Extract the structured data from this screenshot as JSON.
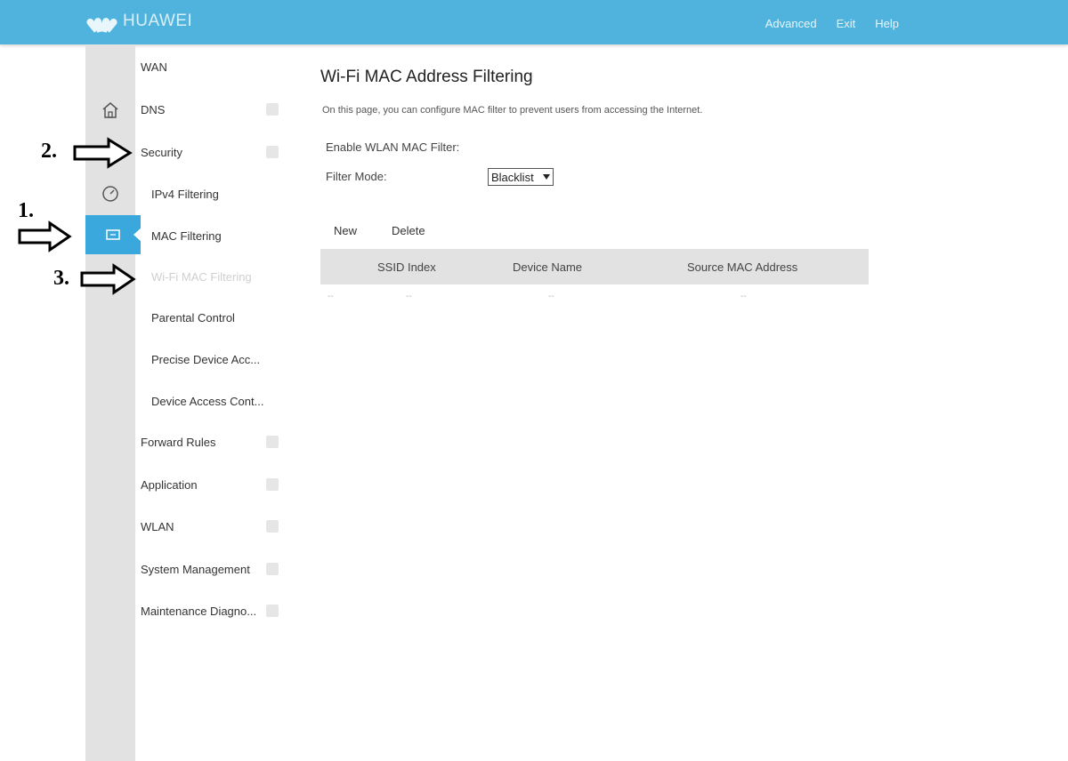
{
  "header": {
    "brand": "HUAWEI",
    "links": [
      "Advanced",
      "Exit",
      "Help"
    ]
  },
  "sidebar": {
    "items": [
      {
        "label": "WAN",
        "type": "header"
      },
      {
        "label": "DNS",
        "type": "header"
      },
      {
        "label": "Security",
        "type": "header"
      },
      {
        "label": "IPv4 Filtering",
        "type": "sub"
      },
      {
        "label": "MAC Filtering",
        "type": "sub"
      },
      {
        "label": "Wi-Fi MAC Filtering",
        "type": "sub"
      },
      {
        "label": "Parental Control",
        "type": "sub"
      },
      {
        "label": "Precise Device Acc...",
        "type": "sub"
      },
      {
        "label": "Device Access Cont...",
        "type": "sub"
      },
      {
        "label": "Forward Rules",
        "type": "header"
      },
      {
        "label": "Application",
        "type": "header"
      },
      {
        "label": "WLAN",
        "type": "header"
      },
      {
        "label": "System Management",
        "type": "header"
      },
      {
        "label": "Maintenance Diagno...",
        "type": "header"
      }
    ]
  },
  "annotations": {
    "one": "1.",
    "two": "2.",
    "three": "3."
  },
  "main": {
    "title": "Wi-Fi MAC Address Filtering",
    "description": "On this page, you can configure MAC filter to prevent users from accessing the Internet.",
    "enable_label": "Enable WLAN MAC Filter:",
    "enable_value": "",
    "filter_mode_label": "Filter Mode:",
    "filter_mode_value": "Blacklist",
    "new_label": "New",
    "delete_label": "Delete",
    "table": {
      "columns": [
        "SSID Index",
        "Device Name",
        "Source MAC Address"
      ],
      "rows": [
        [
          "--",
          "--",
          "--",
          "--"
        ]
      ]
    }
  },
  "colors": {
    "topbar": "#4fb3dd",
    "rail": "#e2e2e2",
    "active": "#3aa8dc"
  }
}
